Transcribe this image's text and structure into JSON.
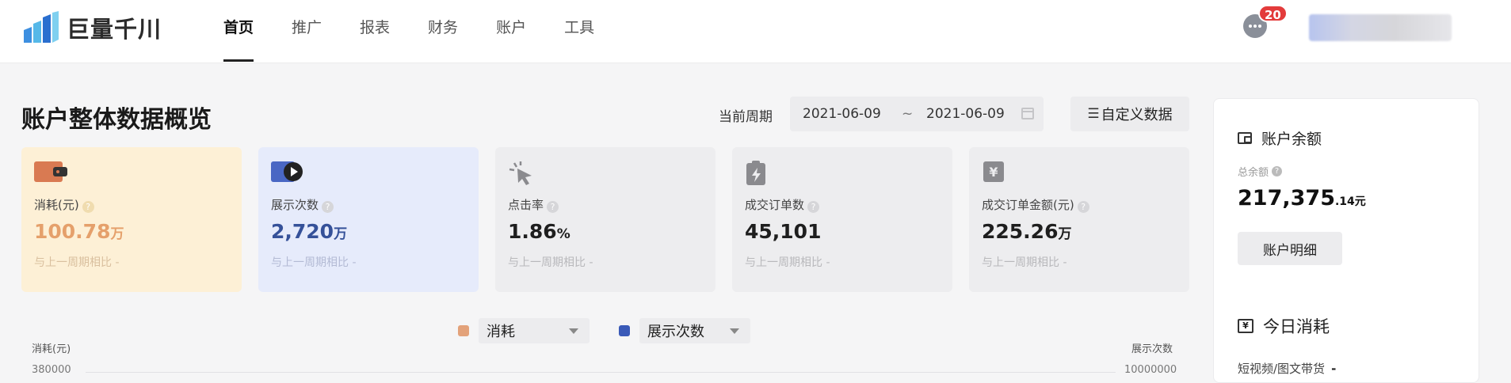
{
  "nav": {
    "logo_text": "巨量千川",
    "items": [
      "首页",
      "推广",
      "报表",
      "财务",
      "账户",
      "工具"
    ],
    "active_index": 0,
    "message_count": "20"
  },
  "overview": {
    "title": "账户整体数据概览",
    "period_label": "当前周期",
    "date_start": "2021-06-09",
    "date_sep": "~",
    "date_end": "2021-06-09",
    "custom_button": "自定义数据"
  },
  "cards": [
    {
      "label": "消耗(元)",
      "value": "100.78",
      "unit": "万",
      "compare": "与上一周期相比 -",
      "icon": "wallet-icon"
    },
    {
      "label": "展示次数",
      "value": "2,720",
      "unit": "万",
      "compare": "与上一周期相比 -",
      "icon": "play-icon"
    },
    {
      "label": "点击率",
      "value": "1.86",
      "unit": "%",
      "compare": "与上一周期相比 -",
      "icon": "click-icon"
    },
    {
      "label": "成交订单数",
      "value": "45,101",
      "unit": "",
      "compare": "与上一周期相比 -",
      "icon": "order-icon"
    },
    {
      "label": "成交订单金额(元)",
      "value": "225.26",
      "unit": "万",
      "compare": "与上一周期相比 -",
      "icon": "yen-icon"
    }
  ],
  "chart": {
    "legend": [
      {
        "name": "消耗",
        "color": "#e3a27a"
      },
      {
        "name": "展示次数",
        "color": "#3a5ab8"
      }
    ],
    "left_axis_label": "消耗(元)",
    "right_axis_label": "展示次数",
    "left_tick_top": "380000",
    "right_tick_top": "10000000"
  },
  "side": {
    "balance_title": "账户余额",
    "total_label": "总余额",
    "total_value": "217,375",
    "total_decimal": ".14",
    "total_unit": "元",
    "detail_button": "账户明细",
    "today_title": "今日消耗",
    "today_line_label": "短视频/图文带货",
    "today_line_value": "-"
  },
  "colors": {
    "accent_warm": "#e5a06b",
    "accent_cool": "#355199",
    "badge": "#e33b3b"
  }
}
